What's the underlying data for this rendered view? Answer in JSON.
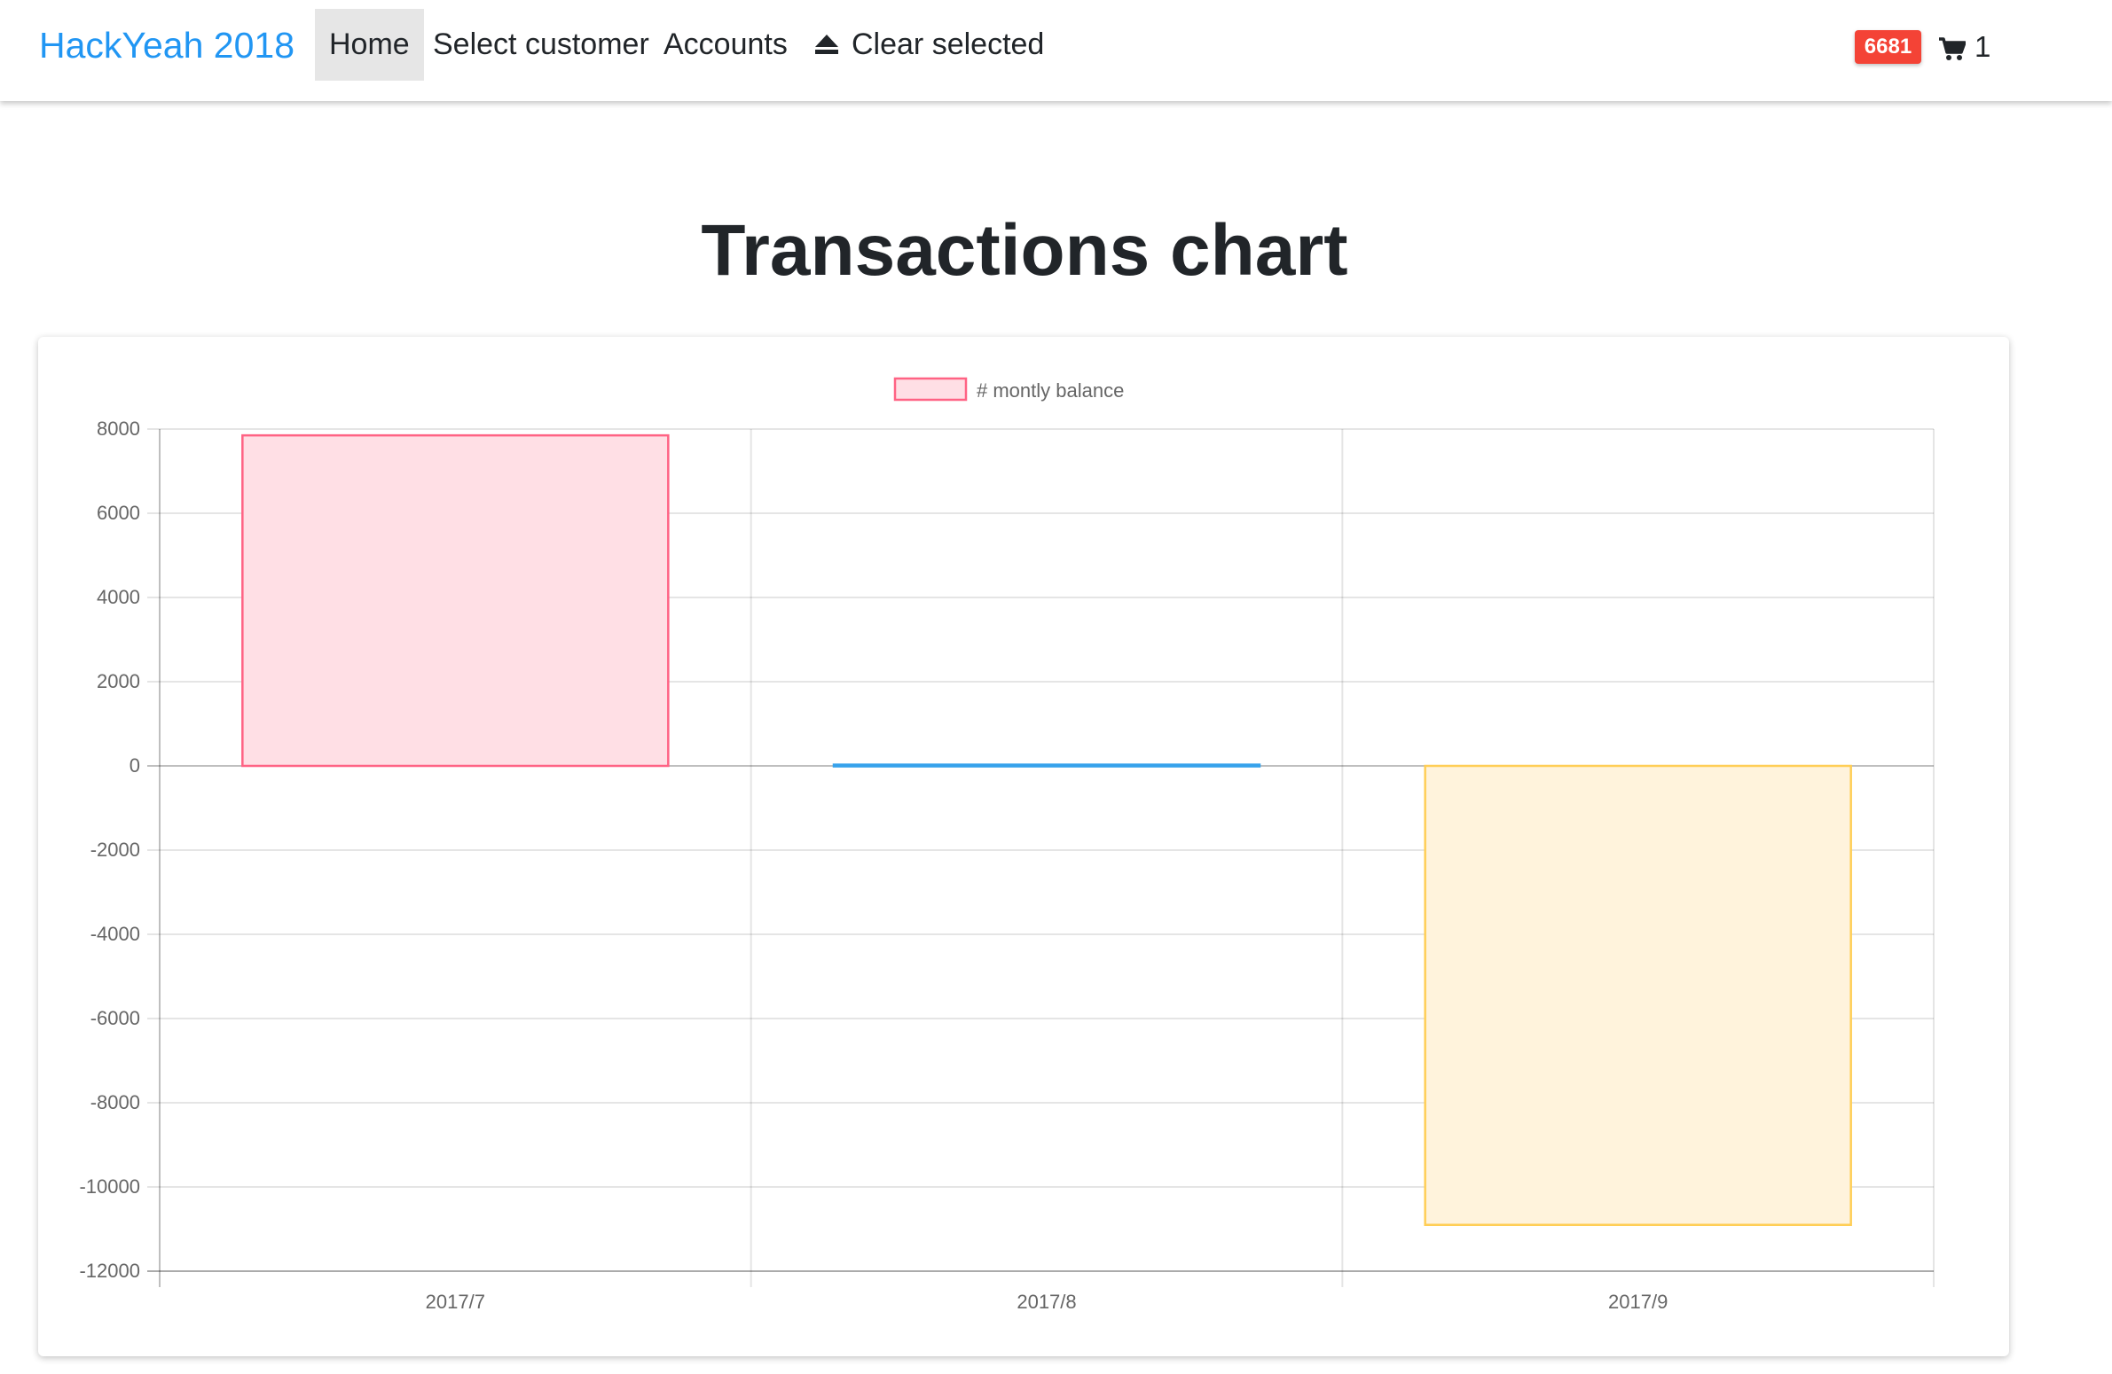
{
  "navbar": {
    "brand": "HackYeah 2018",
    "items": [
      {
        "label": "Home",
        "active": true
      },
      {
        "label": "Select customer"
      },
      {
        "label": "Accounts"
      },
      {
        "label": "Clear selected",
        "icon": "eject-icon"
      }
    ],
    "badge": "6681",
    "cart_icon": "shopping-cart-icon",
    "cart_count": "1"
  },
  "page": {
    "title": "Transactions chart"
  },
  "colors": {
    "brand": "#2196f3",
    "badge": "#f44336"
  },
  "chart_data": {
    "type": "bar",
    "categories": [
      "2017/7",
      "2017/8",
      "2017/9"
    ],
    "series": [
      {
        "name": "# montly balance",
        "values": [
          7850,
          30,
          -10900
        ],
        "fill_colors": [
          "#ffdfe5",
          "#dbeaf7",
          "#fff3dc"
        ],
        "border_colors": [
          "#ff6384",
          "#36a2eb",
          "#ffce56"
        ]
      }
    ],
    "ylim": [
      -12000,
      8000
    ],
    "yticks": [
      8000,
      6000,
      4000,
      2000,
      0,
      -2000,
      -4000,
      -6000,
      -8000,
      -10000,
      -12000
    ],
    "ytick_labels": [
      "8000",
      "6000",
      "4000",
      "2000",
      "0",
      "-2000",
      "-4000",
      "-6000",
      "-8000",
      "-10000",
      "-12000"
    ],
    "grid": true,
    "legend_position": "top"
  }
}
